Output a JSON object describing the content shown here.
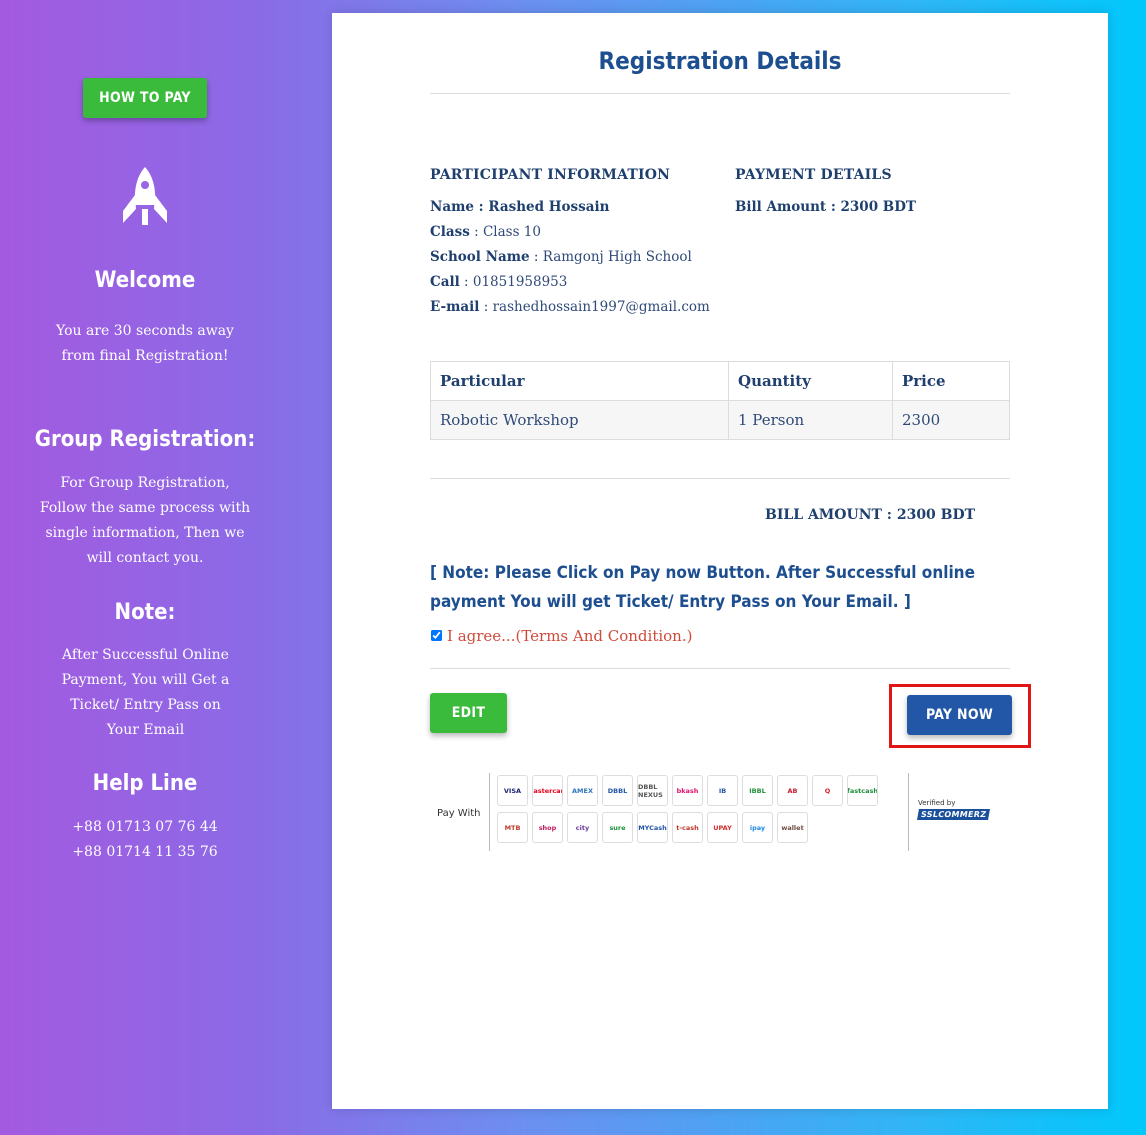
{
  "sidebar": {
    "how_to_pay": "HOW TO PAY",
    "welcome_title": "Welcome",
    "welcome_text": "You are 30 seconds away from final Registration!",
    "group_title": "Group Registration:",
    "group_text": "For Group Registration, Follow the same process with single information, Then we will contact you.",
    "note_title": "Note:",
    "note_text": "After Successful Online Payment, You will Get a Ticket/ Entry Pass on Your Email",
    "help_title": "Help Line",
    "phones": [
      "+88 01713 07 76 44",
      "+88 01714 11 35 76"
    ]
  },
  "card": {
    "title": "Registration Details",
    "participant_heading": "PARTICIPANT INFORMATION",
    "payment_heading": "PAYMENT DETAILS",
    "name_line": "Name : Rashed Hossain",
    "class_label": "Class",
    "class_value": " : Class 10",
    "school_label": "School Name",
    "school_value": " : Ramgonj High School",
    "call_label": "Call",
    "call_value": " : 01851958953",
    "email_label": "E-mail",
    "email_value": " : rashedhossain1997@gmail.com",
    "bill_amount_line": "Bill Amount : 2300 BDT",
    "table": {
      "headers": [
        "Particular",
        "Quantity",
        "Price"
      ],
      "rows": [
        [
          "Robotic Workshop",
          "1 Person",
          "2300"
        ]
      ]
    },
    "bill_total": "BILL AMOUNT : 2300 BDT",
    "note": "[ Note: Please Click on Pay now Button. After Successful online payment You will get Ticket/ Entry Pass on Your Email. ]",
    "agree_text": "I agree...(Terms And Condition.)",
    "agree_checked": true,
    "edit_label": "EDIT",
    "pay_label": "PAY NOW",
    "pay_with": "Pay With",
    "verified_by": "Verified by",
    "ssl_brand": "SSLCOMMERZ",
    "payment_logos": [
      {
        "text": "VISA",
        "color": "#1a1f71"
      },
      {
        "text": "mastercard",
        "color": "#eb001b"
      },
      {
        "text": "AMEX",
        "color": "#2e77bb"
      },
      {
        "text": "DBBL",
        "color": "#2156a5"
      },
      {
        "text": "DBBL NEXUS",
        "color": "#555555"
      },
      {
        "text": "bkash",
        "color": "#e2136e"
      },
      {
        "text": "IB",
        "color": "#2156a5"
      },
      {
        "text": "IBBL",
        "color": "#1f8f3a"
      },
      {
        "text": "AB",
        "color": "#c01f2f"
      },
      {
        "text": "Q",
        "color": "#d4222a"
      },
      {
        "text": "fastcash",
        "color": "#1f8f3a"
      },
      {
        "text": "MTB",
        "color": "#c0392b"
      },
      {
        "text": "shop",
        "color": "#c2185b"
      },
      {
        "text": "city",
        "color": "#6a3a9c"
      },
      {
        "text": "sure",
        "color": "#1f8f3a"
      },
      {
        "text": "MYCash",
        "color": "#2156a5"
      },
      {
        "text": "t-cash",
        "color": "#c0392b"
      },
      {
        "text": "UPAY",
        "color": "#d32f2f"
      },
      {
        "text": "ipay",
        "color": "#1e88e5"
      },
      {
        "text": "wallet",
        "color": "#6d4c41"
      }
    ]
  }
}
